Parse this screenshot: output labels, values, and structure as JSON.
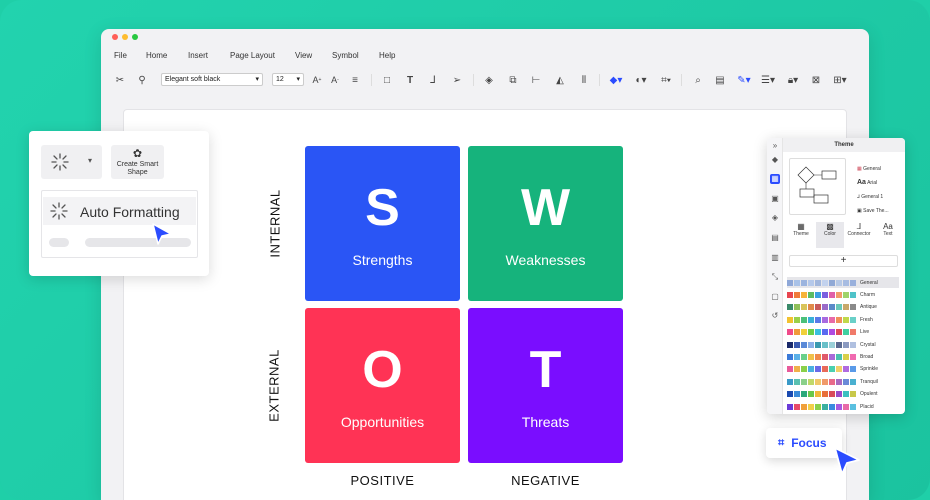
{
  "window": {
    "controls": [
      "close",
      "minimize",
      "maximize"
    ]
  },
  "menu": [
    "File",
    "Home",
    "Insert",
    "Page Layout",
    "View",
    "Symbol",
    "Help"
  ],
  "toolbar": {
    "font": "Elegant soft black",
    "font_size": "12"
  },
  "swot": {
    "s": {
      "letter": "S",
      "word": "Strengths",
      "color": "#2a55f5"
    },
    "w": {
      "letter": "W",
      "word": "Weaknesses",
      "color": "#16b37c"
    },
    "o": {
      "letter": "O",
      "word": "Opportunities",
      "color": "#ff3355"
    },
    "t": {
      "letter": "T",
      "word": "Threats",
      "color": "#7a0dff"
    },
    "row_labels": [
      "INTERNAL",
      "EXTERNAL"
    ],
    "col_labels": [
      "POSITIVE",
      "NEGATIVE"
    ]
  },
  "float_panel": {
    "create_smart_shape": "Create Smart Shape",
    "auto_formatting": "Auto Formatting"
  },
  "theme_panel": {
    "title": "Theme",
    "preview_options": [
      "General",
      "Arial",
      "General 1",
      "Save The..."
    ],
    "tabs": [
      "Theme",
      "Color",
      "Connector",
      "Text"
    ],
    "add": "+",
    "themes": [
      {
        "name": "General",
        "colors": [
          "#8fa8d8",
          "#a9c2e8",
          "#9bb4df",
          "#b4c8ea",
          "#a2b7dd",
          "#c2d2ee",
          "#90a9d6",
          "#b7c9e6",
          "#a7bce2",
          "#99b0dc"
        ]
      },
      {
        "name": "Charm",
        "colors": [
          "#e8454f",
          "#f07a3a",
          "#f6b33a",
          "#5dbb63",
          "#3ca0e0",
          "#7a5fe0",
          "#e05fa8",
          "#f29a6a",
          "#9fd36a",
          "#4fc3c9"
        ]
      },
      {
        "name": "Antique",
        "colors": [
          "#3a8a6a",
          "#8fbf5a",
          "#d9c45a",
          "#e08a4a",
          "#c85a5a",
          "#9a6ac8",
          "#5a8ac8",
          "#6ac8b8",
          "#c8a86a",
          "#8a8a8a"
        ]
      },
      {
        "name": "Fresh",
        "colors": [
          "#f2c230",
          "#9ad04a",
          "#4ac07a",
          "#3ab0d8",
          "#5a7ae8",
          "#a86ae0",
          "#e86aa8",
          "#f0905a",
          "#c0d84a",
          "#6ad0c8"
        ]
      },
      {
        "name": "Live",
        "colors": [
          "#f04a8a",
          "#f09a3a",
          "#f0d03a",
          "#6ad04a",
          "#3ac0e0",
          "#5a6af0",
          "#b04ae0",
          "#e04a5a",
          "#40d0a0",
          "#f07a6a"
        ]
      },
      {
        "name": "Crystal",
        "colors": [
          "#1a2a6a",
          "#3a5ab0",
          "#5a8ad8",
          "#8ab0e8",
          "#3a9ab0",
          "#6ac0c8",
          "#9ad0d8",
          "#5a6a90",
          "#8a9ac0",
          "#b0c0e0"
        ]
      },
      {
        "name": "Broad",
        "colors": [
          "#3a7ad8",
          "#5ab0e8",
          "#6ad08a",
          "#f0c04a",
          "#f08a4a",
          "#e05a6a",
          "#a86ad8",
          "#4ac0b0",
          "#d8d04a",
          "#f06ab0"
        ]
      },
      {
        "name": "Sprinkle",
        "colors": [
          "#e85a9a",
          "#f0b04a",
          "#8ad04a",
          "#4ab0e0",
          "#6a6ae8",
          "#e86a5a",
          "#4ad0b0",
          "#f0d06a",
          "#b06ae0",
          "#5a9ae8"
        ]
      },
      {
        "name": "Tranquil",
        "colors": [
          "#3a9ac8",
          "#5ac0b0",
          "#8ad08a",
          "#c0d86a",
          "#f0c86a",
          "#f09a6a",
          "#e86a8a",
          "#a86ac0",
          "#6a8ad8",
          "#4ab0d0"
        ]
      },
      {
        "name": "Opulent",
        "colors": [
          "#1a4ab0",
          "#3a8ad8",
          "#2aa87a",
          "#6ac84a",
          "#f0b83a",
          "#e8703a",
          "#d84a5a",
          "#9a4ac8",
          "#3ac0c0",
          "#c8c84a"
        ]
      },
      {
        "name": "Placid",
        "colors": [
          "#6a3ad8",
          "#e84a6a",
          "#f0a03a",
          "#f0d04a",
          "#8ad04a",
          "#3ab0a0",
          "#3a8ae0",
          "#a85ae0",
          "#e86aa8",
          "#5ac0e0"
        ]
      }
    ]
  },
  "focus": {
    "label": "Focus"
  },
  "colors": {
    "bg": "#1fcfa8",
    "accent": "#2b4cff"
  }
}
